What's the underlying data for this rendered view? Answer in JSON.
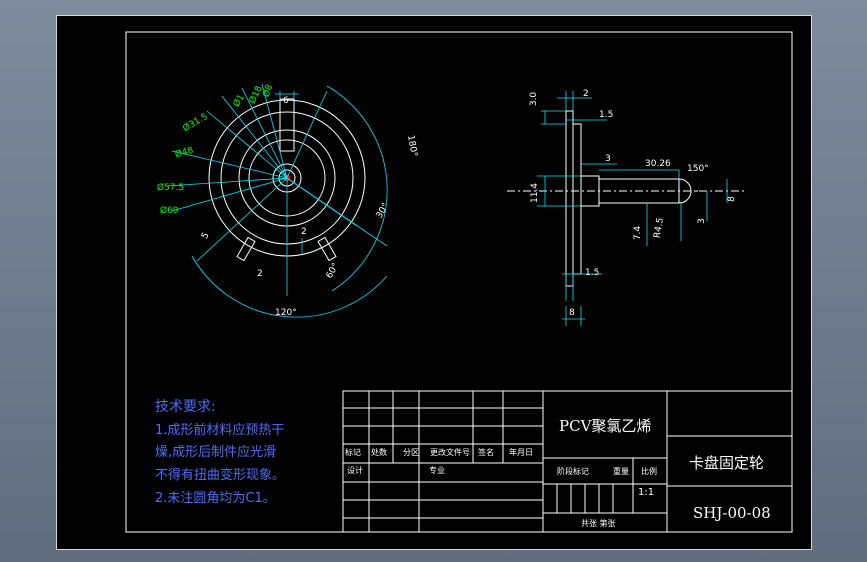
{
  "tech": {
    "title": "技术要求:",
    "line1": "1.成形前材料应预热干",
    "line2": "燥,成形后制件应光滑",
    "line3": "不得有扭曲变形现象。",
    "line4": "2.未注圆角均为C1。"
  },
  "title_block": {
    "material": "PCV聚氯乙烯",
    "part_name": "卡盘固定轮",
    "drawing_no": "SHJ-00-08",
    "scale": "1:1",
    "h_mark": "标记",
    "h_count": "处数",
    "h_zone": "分区",
    "h_change": "更改文件号",
    "h_sign": "签名",
    "h_date": "年月日",
    "h_design": "设计",
    "h_std": "专业",
    "h_stage": "阶段标记",
    "h_weight": "重量",
    "h_ratio": "比例",
    "h_sheet": "共张 第张"
  },
  "dims": {
    "d_phi8": "Ø8",
    "d_phi1": "Ø1",
    "d_phi18": "Ø18",
    "d_phi31": "Ø31.5",
    "d_phi48": "Ø48",
    "d_phi57": "Ø57.5",
    "d_phi69": "Ø69",
    "d_6": "6",
    "d_180": "180°",
    "d_30": "30°",
    "d_60": "60°",
    "d_120": "120°",
    "d_2a": "2",
    "d_2b": "2",
    "d_5": "5",
    "s_30": "3.0",
    "s_2": "2",
    "s_15a": "1.5",
    "s_3": "3",
    "s_302": "30.2",
    "s_6": "6",
    "s_150": "150°",
    "s_114": "11.4",
    "s_74": "7.4",
    "s_r45": "R4.5",
    "s_8": "8",
    "s_3b": "3",
    "s_15b": "1.5",
    "s_8b": "8"
  },
  "colors": {
    "line": "#ffffff",
    "dim": "#00e5ff",
    "green": "#00ff00",
    "note": "#4c6cff",
    "bg": "#000000"
  }
}
